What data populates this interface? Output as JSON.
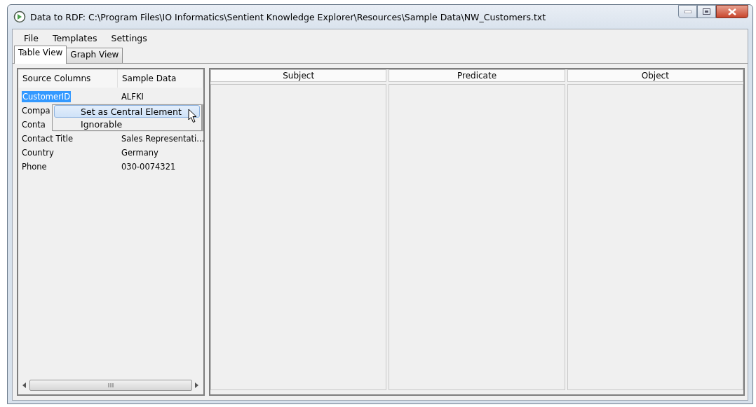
{
  "window": {
    "title": "Data to RDF: C:\\Program Files\\IO Informatics\\Sentient Knowledge Explorer\\Resources\\Sample Data\\NW_Customers.txt"
  },
  "menu": [
    "File",
    "Templates",
    "Settings"
  ],
  "tabs": [
    {
      "label": "Table View",
      "selected": true
    },
    {
      "label": "Graph View",
      "selected": false
    }
  ],
  "source_table": {
    "columns": [
      "Source Columns",
      "Sample Data"
    ],
    "rows": [
      {
        "source": "CustomerID",
        "sample": "ALFKI",
        "selected": true
      },
      {
        "source": "Compa",
        "selected": false
      },
      {
        "source": "Conta",
        "selected": false
      },
      {
        "source": "Contact Title",
        "sample": "Sales Representati...",
        "selected": false
      },
      {
        "source": "Country",
        "sample": "Germany",
        "selected": false
      },
      {
        "source": "Phone",
        "sample": "030-0074321",
        "selected": false
      }
    ]
  },
  "context_menu": {
    "items": [
      {
        "label": "Set as Central Element",
        "selected": true
      },
      {
        "label": "Ignorable",
        "selected": false
      }
    ]
  },
  "mapping_table": {
    "columns": [
      "Subject",
      "Predicate",
      "Object"
    ]
  }
}
